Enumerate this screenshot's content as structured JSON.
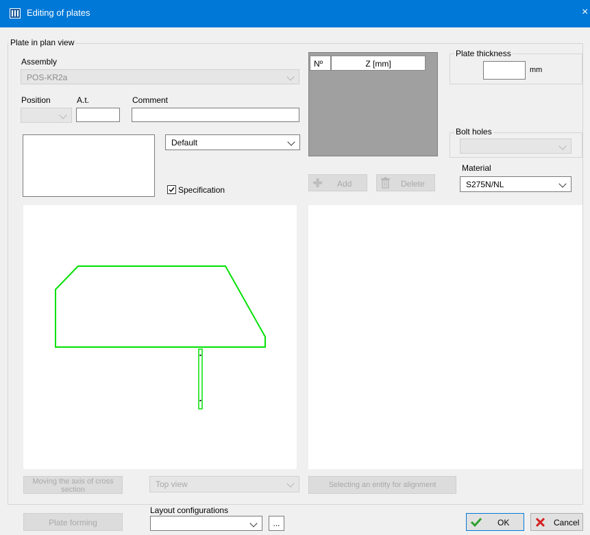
{
  "window": {
    "title": "Editing of plates",
    "close_glyph": "×"
  },
  "plate_group": {
    "legend": "Plate in plan view",
    "assembly_label": "Assembly",
    "assembly_value": "POS-KR2a",
    "position_label": "Position",
    "at_label": "A.t.",
    "comment_label": "Comment",
    "style_value": "Default",
    "specification_label": "Specification"
  },
  "z_table": {
    "col_no": "Nº",
    "col_z": "Z [mm]"
  },
  "table_buttons": {
    "add_label": "Add",
    "delete_label": "Delete"
  },
  "thickness": {
    "legend": "Plate thickness",
    "unit": "mm"
  },
  "bolt": {
    "legend": "Bolt holes"
  },
  "material": {
    "label": "Material",
    "value": "S275N/NL"
  },
  "bottom_controls": {
    "moving_axis_label": "Moving the axis of cross section",
    "view_value": "Top view",
    "select_entity_label": "Selecting an entity for alignment"
  },
  "footer": {
    "plate_forming_label": "Plate forming",
    "layout_label": "Layout configurations",
    "ellipsis_label": "...",
    "ok_label": "OK",
    "cancel_label": "Cancel"
  },
  "colors": {
    "titlebar": "#0078d7",
    "plate_outline": "#00e000",
    "table_area": "#a0a0a0"
  }
}
